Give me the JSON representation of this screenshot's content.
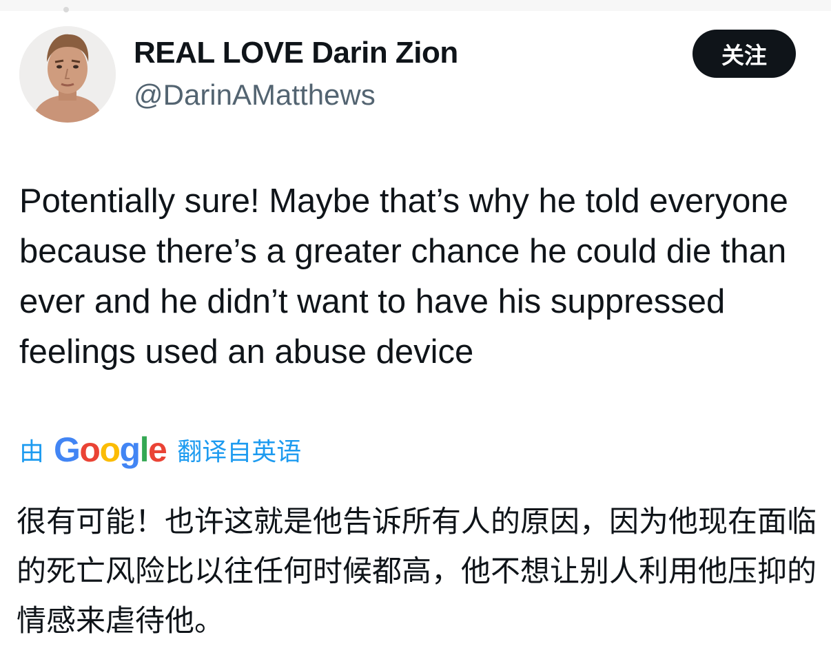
{
  "author": {
    "display_name": "REAL LOVE Darin Zion",
    "handle": "@DarinAMatthews"
  },
  "follow_button": {
    "label": "关注"
  },
  "tweet": {
    "text": "Potentially sure!  Maybe that’s why he told everyone because there’s a greater chance he could die than ever and he didn’t want to have his suppressed feelings used an abuse device"
  },
  "translation": {
    "prefix": "由",
    "logo_letters": [
      {
        "char": "G",
        "color": "#4285f4"
      },
      {
        "char": "o",
        "color": "#ea4335"
      },
      {
        "char": "o",
        "color": "#fbbc05"
      },
      {
        "char": "g",
        "color": "#4285f4"
      },
      {
        "char": "l",
        "color": "#34a853"
      },
      {
        "char": "e",
        "color": "#ea4335"
      }
    ],
    "suffix": "翻译自英语",
    "link_color": "#1d9bf0",
    "text": "很有可能！也许这就是他告诉所有人的原因，因为他现在面临的死亡风险比以往任何时候都高，他不想让别人利用他压抑的情感来虐待他。"
  },
  "colors": {
    "text": "#0f1419",
    "secondary": "#536471",
    "button_bg": "#0f1419"
  },
  "icons": {
    "avatar": "profile-photo"
  }
}
